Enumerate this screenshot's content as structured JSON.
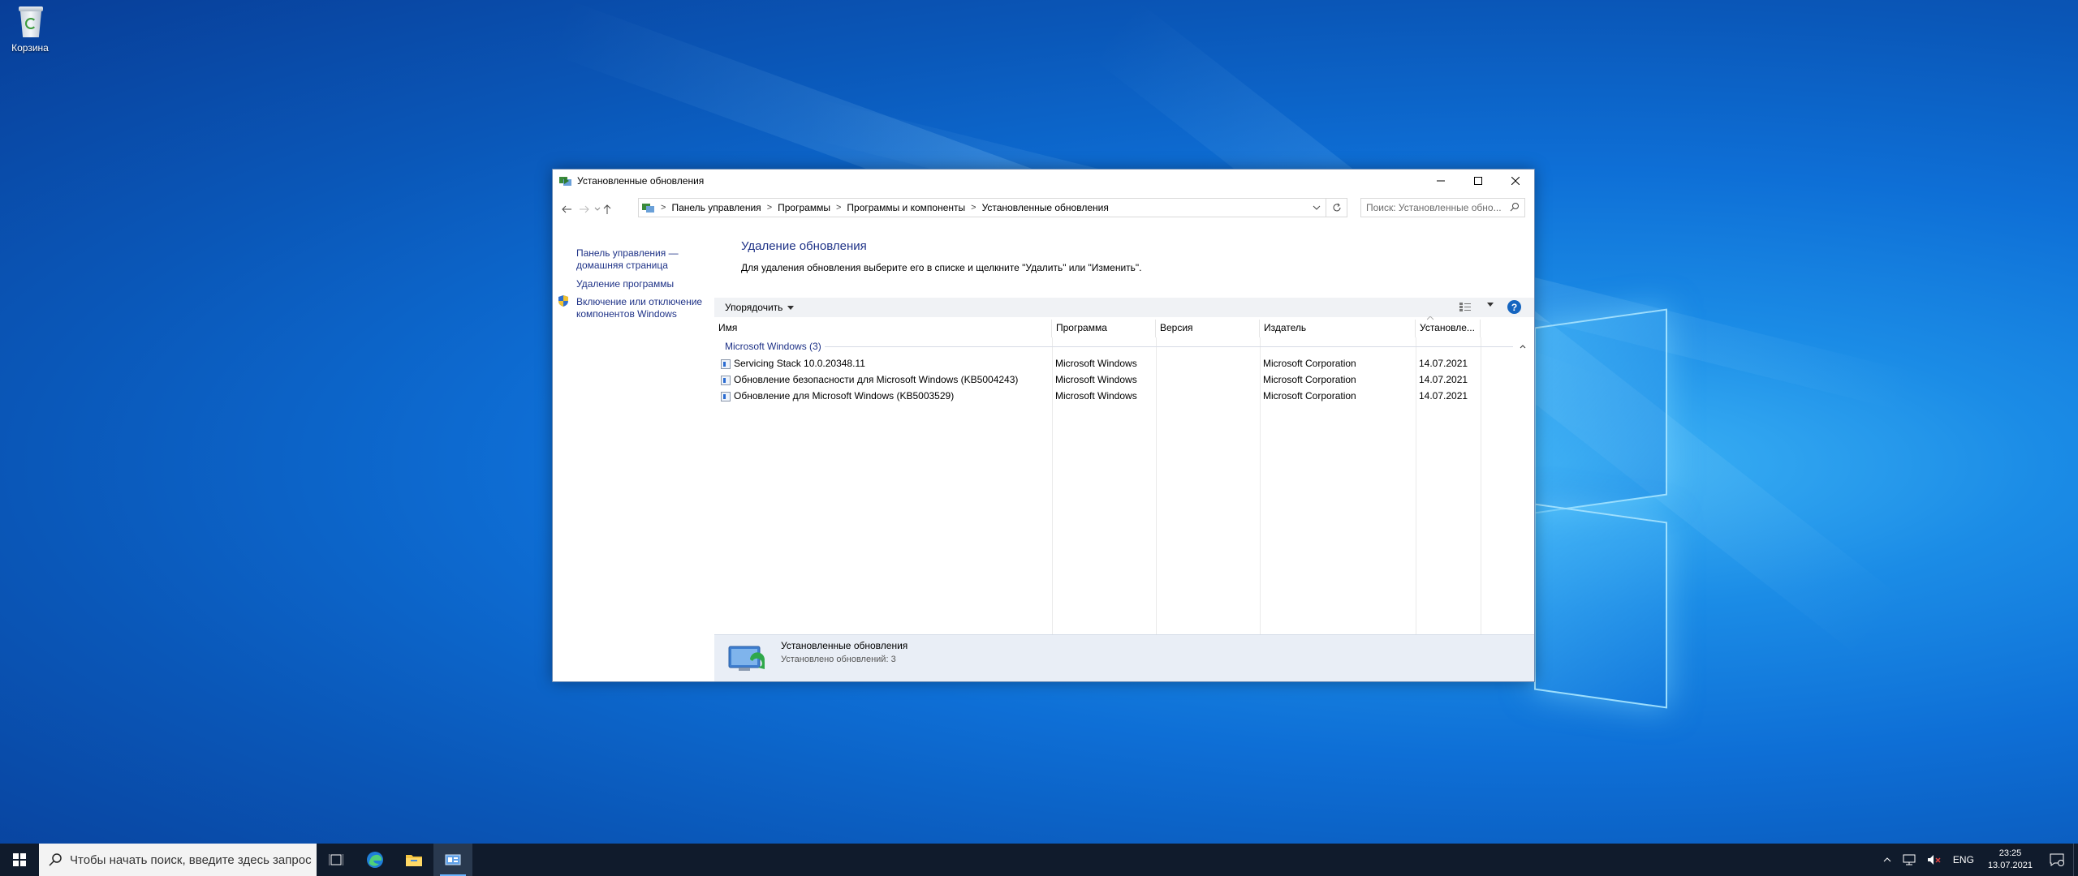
{
  "desktop": {
    "icons": [
      {
        "label": "Корзина",
        "icon": "recycle-bin-icon"
      }
    ],
    "wallpaper_colors": {
      "primary": "#0e6fd6",
      "glow": "#3fb6f7"
    }
  },
  "window": {
    "title": "Установленные обновления",
    "address": {
      "crumbs": [
        "Панель управления",
        "Программы",
        "Программы и компоненты",
        "Установленные обновления"
      ]
    },
    "search_placeholder": "Поиск: Установленные обно...",
    "sidebar": {
      "home_link_line1": "Панель управления —",
      "home_link_line2": "домашняя страница",
      "uninstall_link": "Удаление программы",
      "features_link_line1": "Включение или отключение",
      "features_link_line2": "компонентов Windows"
    },
    "heading": "Удаление обновления",
    "description": "Для удаления обновления выберите его в списке и щелкните \"Удалить\" или \"Изменить\".",
    "toolbar": {
      "organize_label": "Упорядочить",
      "help_label": "?"
    },
    "columns": [
      "Имя",
      "Программа",
      "Версия",
      "Издатель",
      "Установле..."
    ],
    "group": {
      "name": "Microsoft Windows (3)"
    },
    "rows": [
      {
        "name": "Servicing Stack 10.0.20348.11",
        "program": "Microsoft Windows",
        "version": "",
        "publisher": "Microsoft Corporation",
        "installed": "14.07.2021"
      },
      {
        "name": "Обновление безопасности для Microsoft Windows (KB5004243)",
        "program": "Microsoft Windows",
        "version": "",
        "publisher": "Microsoft Corporation",
        "installed": "14.07.2021"
      },
      {
        "name": "Обновление для Microsoft Windows (KB5003529)",
        "program": "Microsoft Windows",
        "version": "",
        "publisher": "Microsoft Corporation",
        "installed": "14.07.2021"
      }
    ],
    "details": {
      "title": "Установленные обновления",
      "subtitle": "Установлено обновлений: 3"
    },
    "colors": {
      "link": "#1e3287",
      "accent": "#1565c0"
    }
  },
  "taskbar": {
    "search_placeholder": "Чтобы начать поиск, введите здесь запрос",
    "pinned": [
      "task-view-icon",
      "edge-icon",
      "file-explorer-icon",
      "control-panel-icon"
    ],
    "tray": {
      "language": "ENG",
      "time": "23:25",
      "date": "13.07.2021"
    }
  }
}
